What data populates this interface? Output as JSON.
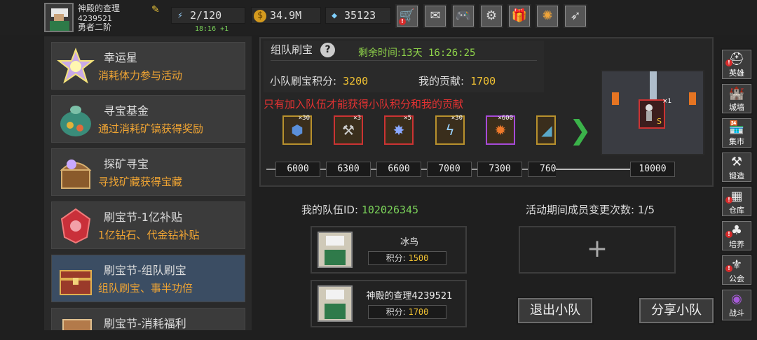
{
  "player": {
    "name": "神殿的查理",
    "id": "4239521",
    "rank": "勇者二阶"
  },
  "resources": {
    "stamina": "2/120",
    "gold": "34.9M",
    "diamond": "35123",
    "stamina_timer": "18:16 +1"
  },
  "toolbar": [
    "shop-cart-icon",
    "mail-icon",
    "gamepad-icon",
    "gear-icon",
    "gift-icon",
    "aperture-icon",
    "feather-icon"
  ],
  "events": [
    {
      "title": "幸运星",
      "desc": "消耗体力参与活动"
    },
    {
      "title": "寻宝基金",
      "desc": "通过消耗矿镐获得奖励"
    },
    {
      "title": "探矿寻宝",
      "desc": "寻找矿藏获得宝藏"
    },
    {
      "title": "刷宝节-1亿补贴",
      "desc": "1亿钻石、代金钻补贴"
    },
    {
      "title": "刷宝节-组队刷宝",
      "desc": "组队刷宝、事半功倍"
    },
    {
      "title": "刷宝节-消耗福利",
      "desc": ""
    }
  ],
  "panel": {
    "title": "组队刷宝",
    "remain_label": "剩余时间:",
    "remain_value": "13天 16:26:25",
    "team_score_label": "小队刷宝积分:",
    "team_score_value": "3200",
    "my_contrib_label": "我的贡献:",
    "my_contrib_value": "1700",
    "warning": "只有加入队伍才能获得小队积分和我的贡献",
    "rewards": [
      {
        "count": "×30",
        "icon": "ore-icon"
      },
      {
        "count": "×3",
        "icon": "pickaxe-icon"
      },
      {
        "count": "×5",
        "icon": "crystal-icon"
      },
      {
        "count": "×30",
        "icon": "lightning-icon"
      },
      {
        "count": "×600",
        "icon": "fire-orb-icon"
      },
      {
        "count": "",
        "icon": "dark-item-icon"
      }
    ],
    "milestones": [
      "6000",
      "6300",
      "6600",
      "7000",
      "7300",
      "760",
      "10000"
    ],
    "scene_slot_count": "×1",
    "scene_slot_grade": "S"
  },
  "team": {
    "id_label": "我的队伍ID:",
    "id_value": "102026345",
    "change_label": "活动期间成员变更次数:",
    "change_value": "1/5",
    "members": [
      {
        "name": "冰鸟",
        "score_label": "积分:",
        "score": "1500"
      },
      {
        "name": "神殿的查理4239521",
        "score_label": "积分:",
        "score": "1700"
      }
    ],
    "add_symbol": "+",
    "leave_button": "退出小队",
    "share_button": "分享小队"
  },
  "sidebar": [
    {
      "label": "英雄",
      "icon": "helmet-icon",
      "badge": true
    },
    {
      "label": "城墙",
      "icon": "wall-icon",
      "badge": false
    },
    {
      "label": "集市",
      "icon": "market-icon",
      "badge": false
    },
    {
      "label": "锻造",
      "icon": "anvil-icon",
      "badge": false
    },
    {
      "label": "仓库",
      "icon": "warehouse-icon",
      "badge": true
    },
    {
      "label": "培养",
      "icon": "tree-icon",
      "badge": true
    },
    {
      "label": "公会",
      "icon": "guild-icon",
      "badge": true
    },
    {
      "label": "战斗",
      "icon": "portal-icon",
      "badge": false
    }
  ],
  "colors": {
    "accent_orange": "#f1a533",
    "accent_green": "#7bd35a",
    "warning_red": "#e43232",
    "score_yellow": "#f1c233",
    "selected_item": "#3b4d63"
  }
}
